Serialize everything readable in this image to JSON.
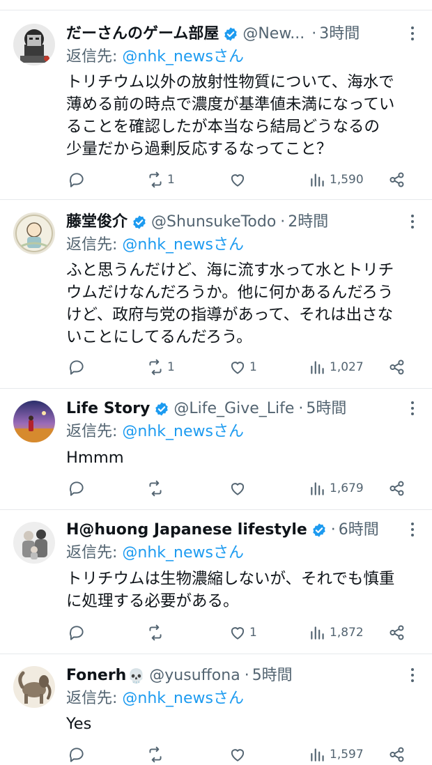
{
  "tweets": [
    {
      "name": "だーさんのゲーム部屋",
      "handle": "@New...",
      "time": "3時間",
      "verified": true,
      "reply_prefix": "返信先: ",
      "reply_to": "@nhk_newsさん",
      "text_lines": [
        "トリチウム以外の放射性物質について、海水で",
        "薄める前の時点で濃度が基準値未満になってい",
        "ることを確認したが本当なら結局どうなるの",
        "少量だから過剰反応するなってこと？"
      ],
      "retweets": "1",
      "likes": "",
      "views": "1,590"
    },
    {
      "name": "藤堂俊介",
      "handle": "@ShunsukeTodo",
      "time": "2時間",
      "verified": true,
      "reply_prefix": "返信先: ",
      "reply_to": "@nhk_newsさん",
      "text_lines": [
        "ふと思うんだけど、海に流す水って水とトリチ",
        "ウムだけなんだろうか。他に何かあるんだろう",
        "けど、政府与党の指導があって、それは出さな",
        "いことにしてるんだろう。"
      ],
      "retweets": "1",
      "likes": "1",
      "views": "1,027"
    },
    {
      "name": "Life Story",
      "handle": "@Life_Give_Life",
      "time": "5時間",
      "verified": true,
      "reply_prefix": "返信先: ",
      "reply_to": "@nhk_newsさん",
      "text_lines": [
        "Hmmm"
      ],
      "retweets": "",
      "likes": "",
      "views": "1,679"
    },
    {
      "name": "H@huong Japanese lifestyle",
      "handle": "",
      "time": "6時間",
      "verified": true,
      "reply_prefix": "返信先: ",
      "reply_to": "@nhk_newsさん",
      "text_lines": [
        "トリチウムは生物濃縮しないが、それでも慎重",
        "に処理する必要がある。"
      ],
      "retweets": "",
      "likes": "1",
      "views": "1,872"
    },
    {
      "name": "Fonerh",
      "name_emoji": "💀",
      "handle": "@yusuffona",
      "time": "5時間",
      "verified": false,
      "reply_prefix": "返信先: ",
      "reply_to": "@nhk_newsさん",
      "text_lines": [
        "Yes"
      ],
      "retweets": "",
      "likes": "",
      "views": "1,597"
    }
  ],
  "colors": {
    "accent": "#1d9bf0",
    "secondary_text": "#536471",
    "primary_text": "#0f1419",
    "divider": "#e6e9ec"
  },
  "icons": {
    "reply": "reply-icon",
    "retweet": "retweet-icon",
    "like": "heart-icon",
    "views": "views-chart-icon",
    "share": "share-icon",
    "more": "more-vertical-icon",
    "verified": "verified-badge-icon"
  }
}
